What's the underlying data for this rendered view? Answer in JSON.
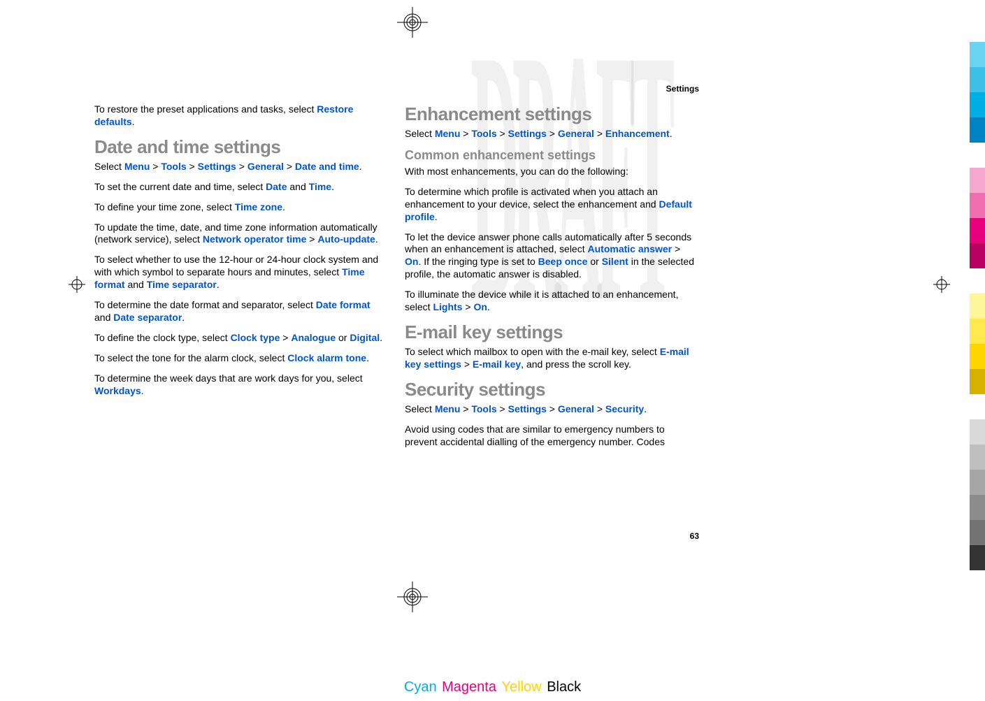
{
  "header": {
    "section": "Settings"
  },
  "page_number": "63",
  "watermark": "DRAFT",
  "left_col": {
    "p_restore": {
      "t1": "To restore the preset applications and tasks, select ",
      "u1": "Restore defaults",
      "t2": "."
    },
    "h_datetime": "Date and time settings",
    "p_select_dt": {
      "t1": "Select ",
      "u1": "Menu",
      "s1": " > ",
      "u2": "Tools",
      "s2": " > ",
      "u3": "Settings",
      "s3": " > ",
      "u4": "General",
      "s4": " > ",
      "u5": "Date and time",
      "t2": "."
    },
    "p_setdt": {
      "t1": "To set the current date and time, select ",
      "u1": "Date",
      "t2": " and ",
      "u2": "Time",
      "t3": "."
    },
    "p_tz": {
      "t1": "To define your time zone, select ",
      "u1": "Time zone",
      "t2": "."
    },
    "p_update": {
      "t1": "To update the time, date, and time zone information automatically (network service), select ",
      "u1": "Network operator time",
      "s1": " > ",
      "u2": "Auto-update",
      "t2": "."
    },
    "p_clockfmt": {
      "t1": "To select whether to use the 12-hour or 24-hour clock system and with which symbol to separate hours and minutes, select ",
      "u1": "Time format",
      "t2": " and ",
      "u2": "Time separator",
      "t3": "."
    },
    "p_datefmt": {
      "t1": "To determine the date format and separator, select ",
      "u1": "Date format",
      "t2": " and ",
      "u2": "Date separator",
      "t3": "."
    },
    "p_clocktype": {
      "t1": "To define the clock type, select ",
      "u1": "Clock type",
      "s1": " > ",
      "u2": "Analogue",
      "t2": " or ",
      "u3": "Digital",
      "t3": "."
    },
    "p_alarm": {
      "t1": "To select the tone for the alarm clock, select ",
      "u1": "Clock alarm tone",
      "t2": "."
    },
    "p_work": {
      "t1": "To determine the week days that are work days for you, select ",
      "u1": "Workdays",
      "t2": "."
    }
  },
  "right_col": {
    "h_enh": "Enhancement settings",
    "p_select_enh": {
      "t1": "Select ",
      "u1": "Menu",
      "s1": " > ",
      "u2": "Tools",
      "s2": " > ",
      "u3": "Settings",
      "s3": " > ",
      "u4": "General",
      "s4": " > ",
      "u5": "Enhancement",
      "t2": "."
    },
    "h_common": "Common enhancement settings",
    "p_withmost": {
      "t1": "With most enhancements, you can do the following:"
    },
    "p_profile": {
      "t1": "To determine which profile is activated when you attach an enhancement to your device, select the enhancement and ",
      "u1": "Default profile",
      "t2": "."
    },
    "p_autoanswer": {
      "t1": "To let the device answer phone calls automatically after 5 seconds when an enhancement is attached, select ",
      "u1": "Automatic answer",
      "s1": " > ",
      "u2": "On",
      "t2": ". If the ringing type is set to ",
      "u3": "Beep once",
      "t3": " or ",
      "u4": "Silent",
      "t4": " in the selected profile, the automatic answer is disabled."
    },
    "p_lights": {
      "t1": "To illuminate the device while it is attached to an enhancement, select ",
      "u1": "Lights",
      "s1": " > ",
      "u2": "On",
      "t2": "."
    },
    "h_email": "E-mail key settings",
    "p_email": {
      "t1": "To select which mailbox to open with the e-mail key, select ",
      "u1": "E-mail key settings",
      "s1": " > ",
      "u2": "E-mail key",
      "t2": ", and press the scroll key."
    },
    "h_sec": "Security settings",
    "p_select_sec": {
      "t1": "Select ",
      "u1": "Menu",
      "s1": " > ",
      "u2": "Tools",
      "s2": " > ",
      "u3": "Settings",
      "s3": " > ",
      "u4": "General",
      "s4": " > ",
      "u5": "Security",
      "t2": "."
    },
    "p_avoid": {
      "t1": "Avoid using codes that are similar to emergency numbers to prevent accidental dialling of the emergency number. Codes"
    }
  },
  "footer": {
    "cyan": "Cyan",
    "magenta": "Magenta",
    "yellow": "Yellow",
    "black": "Black"
  },
  "colorbars": [
    "#6ad4f0",
    "#3cc0e8",
    "#00aee6",
    "#0083c4",
    "spacer",
    "#f6a8cf",
    "#ef6eb0",
    "#e6007e",
    "#b70062",
    "spacer",
    "#fff59b",
    "#ffe94d",
    "#ffd400",
    "#d6b200",
    "spacer",
    "#d9d9d9",
    "#bfbfbf",
    "#a6a6a6",
    "#8c8c8c",
    "#737373",
    "#333333"
  ]
}
